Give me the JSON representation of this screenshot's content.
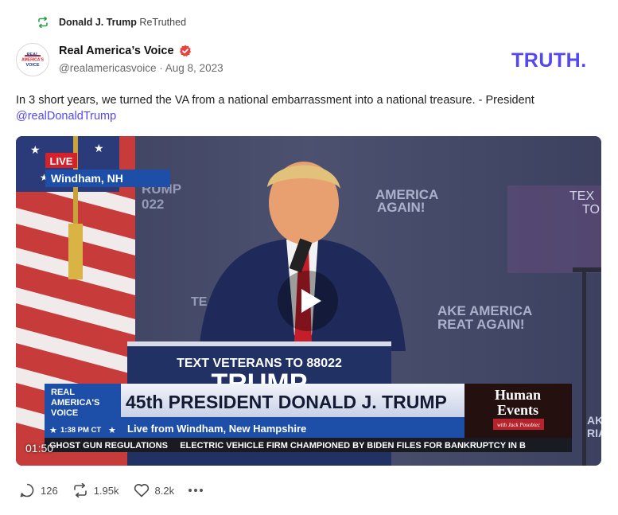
{
  "retruth": {
    "icon": "retruth-icon",
    "name": "Donald J. Trump",
    "suffix": "ReTruthed"
  },
  "author": {
    "name": "Real America’s Voice",
    "handle": "@realamericasvoice",
    "separator": "·",
    "date": "Aug 8, 2023",
    "avatar_lines": [
      "REAL",
      "AMERICA'S",
      "VOICE"
    ],
    "verified_icon": "verified-badge-icon"
  },
  "brand": {
    "logo_text": "TRUTH.",
    "color": "#5448ee"
  },
  "post": {
    "text": "In 3 short years, we turned the VA from a national embarrassment into a national treasure. - President ",
    "mention": "@realDonaldTrump"
  },
  "video": {
    "duration": "01:50",
    "play_icon": "play-icon",
    "live_badge": "LIVE",
    "location": "Windham, NH",
    "lower_third_network": [
      "REAL",
      "AMERICA'S",
      "VOICE"
    ],
    "lower_third_time": "1:38 PM CT",
    "headline": "45th PRESIDENT DONALD J. TRUMP",
    "subhead": "Live from Windham, New Hampshire",
    "sponsor_lines": [
      "Human",
      "Events"
    ],
    "sponsor_sub": "with Jack Posobiec",
    "ticker": "GHOST GUN REGULATIONS     ELECTRIC VEHICLE FIRM CHAMPIONED BY BIDEN FILES FOR BANKRUPTCY IN B",
    "podium_text": "TEXT VETERANS TO 88022",
    "podium_big": "TRUMP",
    "backdrop_left": [
      "RUMP",
      "022"
    ],
    "backdrop_right_top": [
      "AMERICA",
      "AGAIN!"
    ],
    "backdrop_right_mid": [
      "AKE AMERICA",
      "REAT AGAIN!"
    ],
    "backdrop_far_right": [
      "TEX",
      "TO"
    ],
    "backdrop_te": "TE",
    "backdrop_edge": [
      "AKE",
      "RIA"
    ]
  },
  "actions": {
    "reply_count": "126",
    "retruth_count": "1.95k",
    "like_count": "8.2k",
    "reply_icon": "reply-icon",
    "retruth_icon": "retruth-icon",
    "like_icon": "heart-icon",
    "more_icon": "more-icon"
  },
  "colors": {
    "accent": "#5448ee",
    "retruth_green": "#2aa24a",
    "verified_red": "#e6453e",
    "live_red": "#d6202a",
    "lower_blue": "#1d4fa8"
  }
}
